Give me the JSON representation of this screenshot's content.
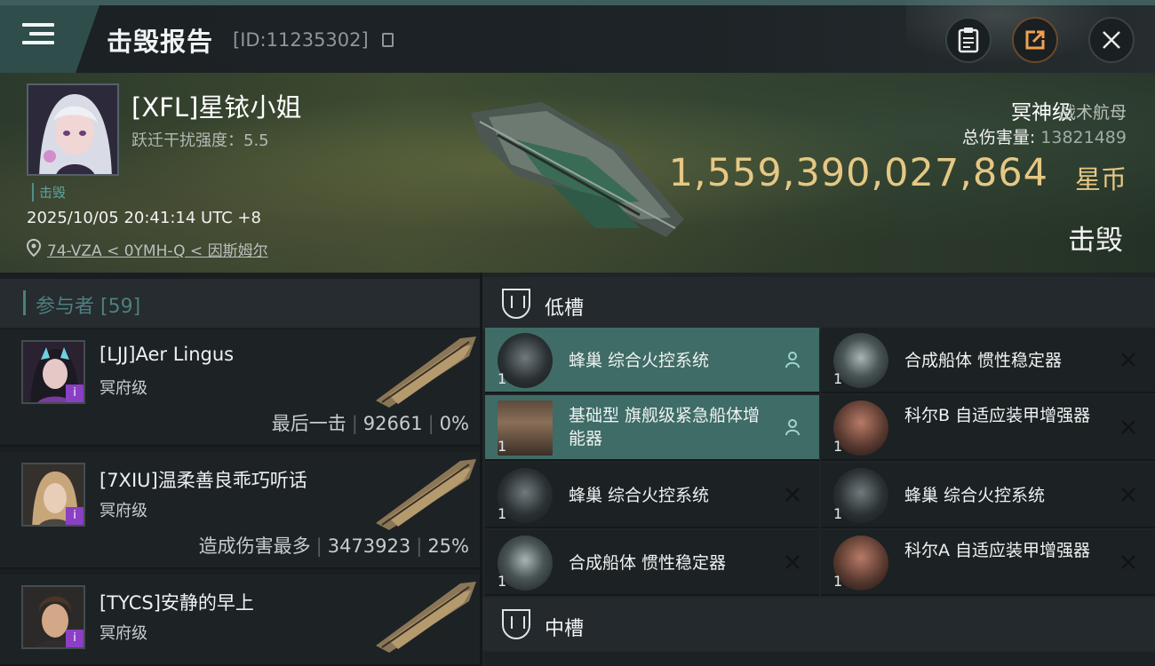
{
  "header": {
    "title": "击毁报告",
    "report_id": "[ID:11235302]"
  },
  "victim": {
    "name": "[XFL]星铱小姐",
    "jam_strength": "跃迁干扰强度：5.5",
    "status_tag": "击毁",
    "timestamp": "2025/10/05 20:41:14 UTC +8",
    "location": "74-VZA < 0YMH-Q < 因斯姆尔",
    "ship_name": "冥神级",
    "ship_class": "战术航母",
    "total_damage_label": "总伤害量:",
    "total_damage_value": "13821489",
    "isk_value": "1,559,390,027,864",
    "isk_unit": "星币",
    "result": "击毁"
  },
  "participants": {
    "title": "参与者 [59]",
    "items": [
      {
        "name": "[LJJ]Aer Lingus",
        "ship": "冥府级",
        "stats": [
          "最后一击",
          "92661",
          "0%"
        ]
      },
      {
        "name": "[7XIU]温柔善良乖巧听话",
        "ship": "冥府级",
        "stats": [
          "造成伤害最多",
          "3473923",
          "25%"
        ]
      },
      {
        "name": "[TYCS]安静的早上",
        "ship": "冥府级",
        "stats": []
      }
    ]
  },
  "fitting": {
    "low_slot_title": "低槽",
    "mid_slot_title": "中槽",
    "low_modules": [
      {
        "name": "蜂巢 综合火控系统",
        "qty": "1",
        "state": "dropped"
      },
      {
        "name": "合成船体 惯性稳定器",
        "qty": "1",
        "state": "destroyed"
      },
      {
        "name": "基础型 旗舰级紧急船体增能器",
        "qty": "1",
        "state": "dropped"
      },
      {
        "name": "科尔B 自适应装甲增强器",
        "qty": "1",
        "state": "destroyed"
      },
      {
        "name": "蜂巢 综合火控系统",
        "qty": "1",
        "state": "destroyed"
      },
      {
        "name": "蜂巢 综合火控系统",
        "qty": "1",
        "state": "destroyed"
      },
      {
        "name": "合成船体 惯性稳定器",
        "qty": "1",
        "state": "destroyed"
      },
      {
        "name": "科尔A 自适应装甲增强器",
        "qty": "1",
        "state": "destroyed"
      }
    ]
  },
  "colors": {
    "accent_teal": "#3f6c66",
    "isk_gold": "#e5c884",
    "badge_purple": "#8b3fc5"
  }
}
